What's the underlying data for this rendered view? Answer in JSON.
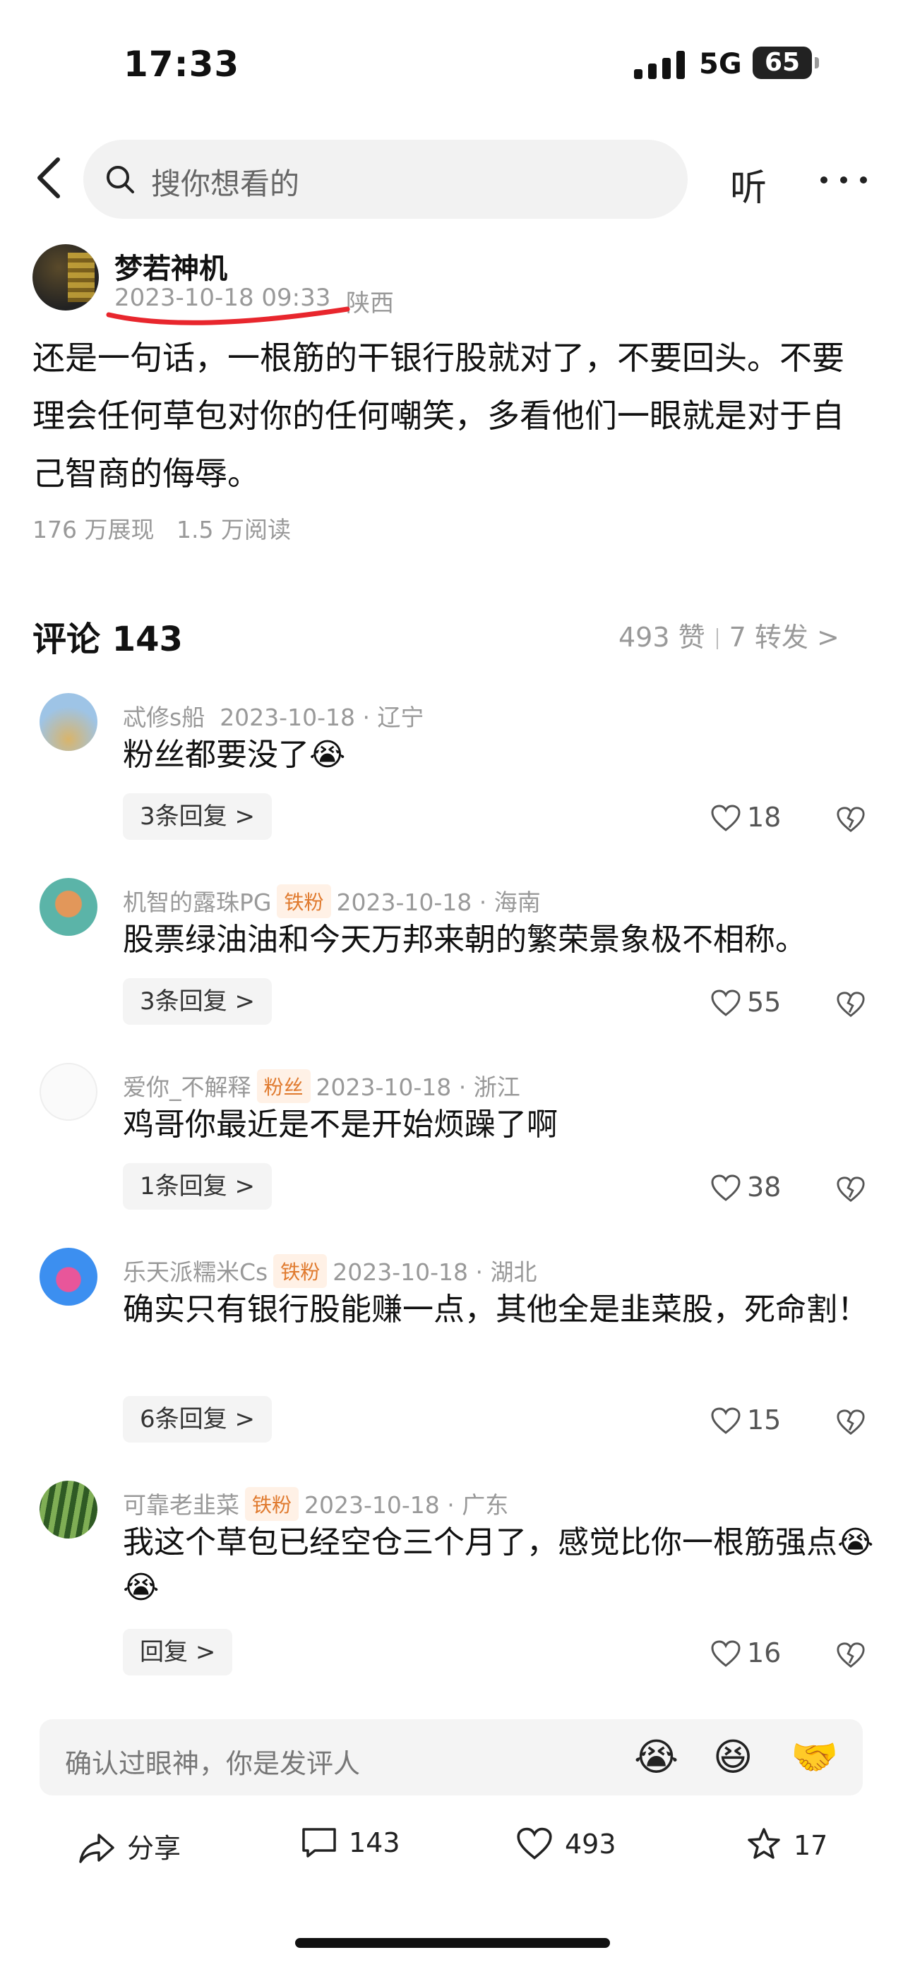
{
  "status_bar": {
    "time": "17:33",
    "network": "5G",
    "battery": "65"
  },
  "header": {
    "search_placeholder": "搜你想看的",
    "listen_label": "听"
  },
  "post": {
    "author": "梦若神机",
    "time": "2023-10-18 09:33",
    "region": "陕西",
    "text": "还是一句话，一根筋的干银行股就对了，不要回头。不要理会任何草包对你的任何嘲笑，多看他们一眼就是对于自己智商的侮辱。",
    "impressions": "176 万展现",
    "reads": "1.5 万阅读"
  },
  "comments_header": {
    "title": "评论 143",
    "likes": "493 赞",
    "forwards": "7 转发"
  },
  "comments": [
    {
      "name": "忒修s船",
      "badge": "",
      "meta": "2023-10-18 · 辽宁",
      "text": "粉丝都要没了",
      "emoji": "😭",
      "reply": "3条回复",
      "likes": "18"
    },
    {
      "name": "机智的露珠PG",
      "badge": "铁粉",
      "meta": "2023-10-18 · 海南",
      "text": "股票绿油油和今天万邦来朝的繁荣景象极不相称。",
      "emoji": "",
      "reply": "3条回复",
      "likes": "55"
    },
    {
      "name": "爱你_不解释",
      "badge": "粉丝",
      "meta": "2023-10-18 · 浙江",
      "text": "鸡哥你最近是不是开始烦躁了啊",
      "emoji": "",
      "reply": "1条回复",
      "likes": "38"
    },
    {
      "name": "乐天派糯米Cs",
      "badge": "铁粉",
      "meta": "2023-10-18 · 湖北",
      "text": "确实只有银行股能赚一点，其他全是韭菜股，死命割！",
      "emoji": "",
      "reply": "6条回复",
      "likes": "15"
    },
    {
      "name": "可靠老韭菜",
      "badge": "铁粉",
      "meta": "2023-10-18 · 广东",
      "text": "我这个草包已经空仓三个月了，感觉比你一根筋强点",
      "emoji": "😭😭",
      "reply": "回复",
      "likes": "16"
    }
  ],
  "comment_input": {
    "placeholder": "确认过眼神，你是发评人",
    "emojis": [
      "😭",
      "😆",
      "🤝"
    ]
  },
  "bottom_bar": {
    "share": "分享",
    "comments": "143",
    "likes": "493",
    "favorites": "17"
  }
}
